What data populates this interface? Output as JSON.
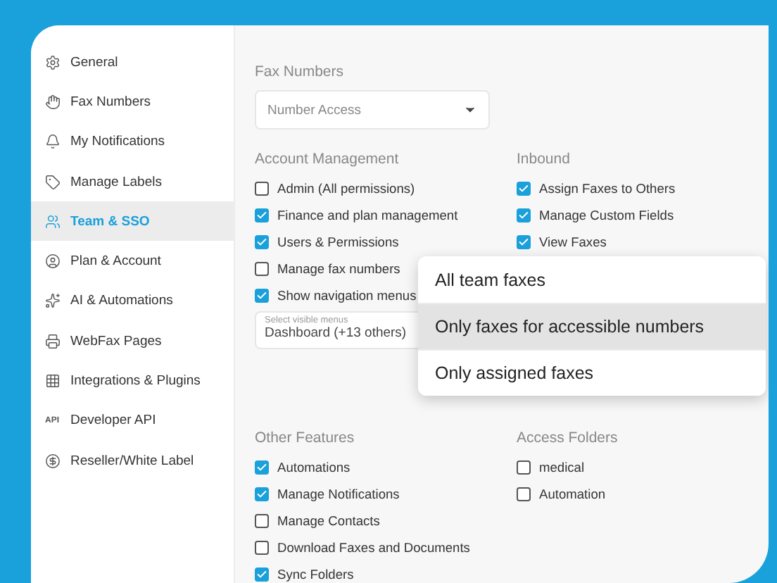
{
  "sidebar": {
    "items": [
      {
        "label": "General",
        "selected": false
      },
      {
        "label": "Fax Numbers",
        "selected": false
      },
      {
        "label": "My Notifications",
        "selected": false
      },
      {
        "label": "Manage Labels",
        "selected": false
      },
      {
        "label": "Team & SSO",
        "selected": true
      },
      {
        "label": "Plan & Account",
        "selected": false
      },
      {
        "label": "AI & Automations",
        "selected": false
      },
      {
        "label": "WebFax Pages",
        "selected": false
      },
      {
        "label": "Integrations & Plugins",
        "selected": false
      },
      {
        "label": "Developer API",
        "selected": false,
        "icon_text": "API"
      },
      {
        "label": "Reseller/White Label",
        "selected": false
      }
    ]
  },
  "fax_numbers": {
    "title": "Fax Numbers",
    "select": {
      "placeholder": "Number Access"
    }
  },
  "account_management": {
    "title": "Account Management",
    "options": [
      {
        "label": "Admin (All permissions)",
        "checked": false
      },
      {
        "label": "Finance and plan management",
        "checked": true
      },
      {
        "label": "Users & Permissions",
        "checked": true
      },
      {
        "label": "Manage fax numbers",
        "checked": false
      },
      {
        "label": "Show navigation menus",
        "checked": true
      }
    ],
    "visible_menus": {
      "label": "Select visible menus",
      "value": "Dashboard (+13 others)"
    }
  },
  "inbound": {
    "title": "Inbound",
    "options": [
      {
        "label": "Assign Faxes to Others",
        "checked": true
      },
      {
        "label": "Manage Custom Fields",
        "checked": true
      },
      {
        "label": "View Faxes",
        "checked": true
      }
    ]
  },
  "dropdown": {
    "options": [
      {
        "label": "All team faxes",
        "selected": false
      },
      {
        "label": "Only faxes for accessible numbers",
        "selected": true
      },
      {
        "label": "Only assigned faxes",
        "selected": false
      }
    ]
  },
  "other_features": {
    "title": "Other Features",
    "options": [
      {
        "label": "Automations",
        "checked": true
      },
      {
        "label": "Manage Notifications",
        "checked": true
      },
      {
        "label": "Manage Contacts",
        "checked": false
      },
      {
        "label": "Download Faxes and Documents",
        "checked": false
      },
      {
        "label": "Sync Folders",
        "checked": true
      }
    ]
  },
  "access_folders": {
    "title": "Access Folders",
    "options": [
      {
        "label": "medical",
        "checked": false
      },
      {
        "label": "Automation",
        "checked": false
      }
    ]
  }
}
